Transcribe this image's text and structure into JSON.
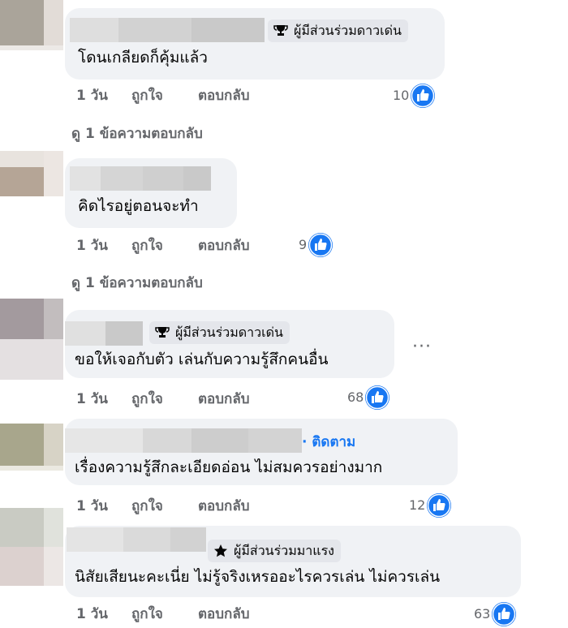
{
  "comments": [
    {
      "badge": "ผู้มีส่วนร่วมดาวเด่น",
      "text": "โดนเกลียดก็คุ้มแล้ว",
      "time": "1 วัน",
      "like": "ถูกใจ",
      "reply": "ตอบกลับ",
      "likes": "10",
      "replies_link": "ดู 1 ข้อความตอบกลับ"
    },
    {
      "text": "คิดไรอยู่ตอนจะทำ",
      "time": "1 วัน",
      "like": "ถูกใจ",
      "reply": "ตอบกลับ",
      "likes": "9",
      "replies_link": "ดู 1 ข้อความตอบกลับ"
    },
    {
      "badge": "ผู้มีส่วนร่วมดาวเด่น",
      "text": "ขอให้เจอกับตัว เล่นกับความรู้สึกคนอื่น",
      "time": "1 วัน",
      "like": "ถูกใจ",
      "reply": "ตอบกลับ",
      "likes": "68",
      "more": "···"
    },
    {
      "follow": "· ติดตาม",
      "text": "เรื่องความรู้สึกละเอียดอ่อน ไม่สมควรอย่างมาก",
      "time": "1 วัน",
      "like": "ถูกใจ",
      "reply": "ตอบกลับ",
      "likes": "12"
    },
    {
      "badge": "ผู้มีส่วนร่วมมาแรง",
      "text": "นิสัยเสียนะคะเนี่ย ไม่รู้จริงเหรออะไรควรเล่น ไม่ควรเล่น",
      "time": "1 วัน",
      "like": "ถูกใจ",
      "reply": "ตอบกลับ",
      "likes": "63"
    }
  ],
  "colors": {
    "bubble": "#f0f2f5",
    "badge": "#e4e6eb",
    "link_blue": "#1877f2",
    "muted": "#65676b"
  },
  "icons": {
    "top_fan": "trophy-icon",
    "rising_fan": "star-icon",
    "like": "thumbs-up-icon",
    "more": "more-options-icon"
  }
}
